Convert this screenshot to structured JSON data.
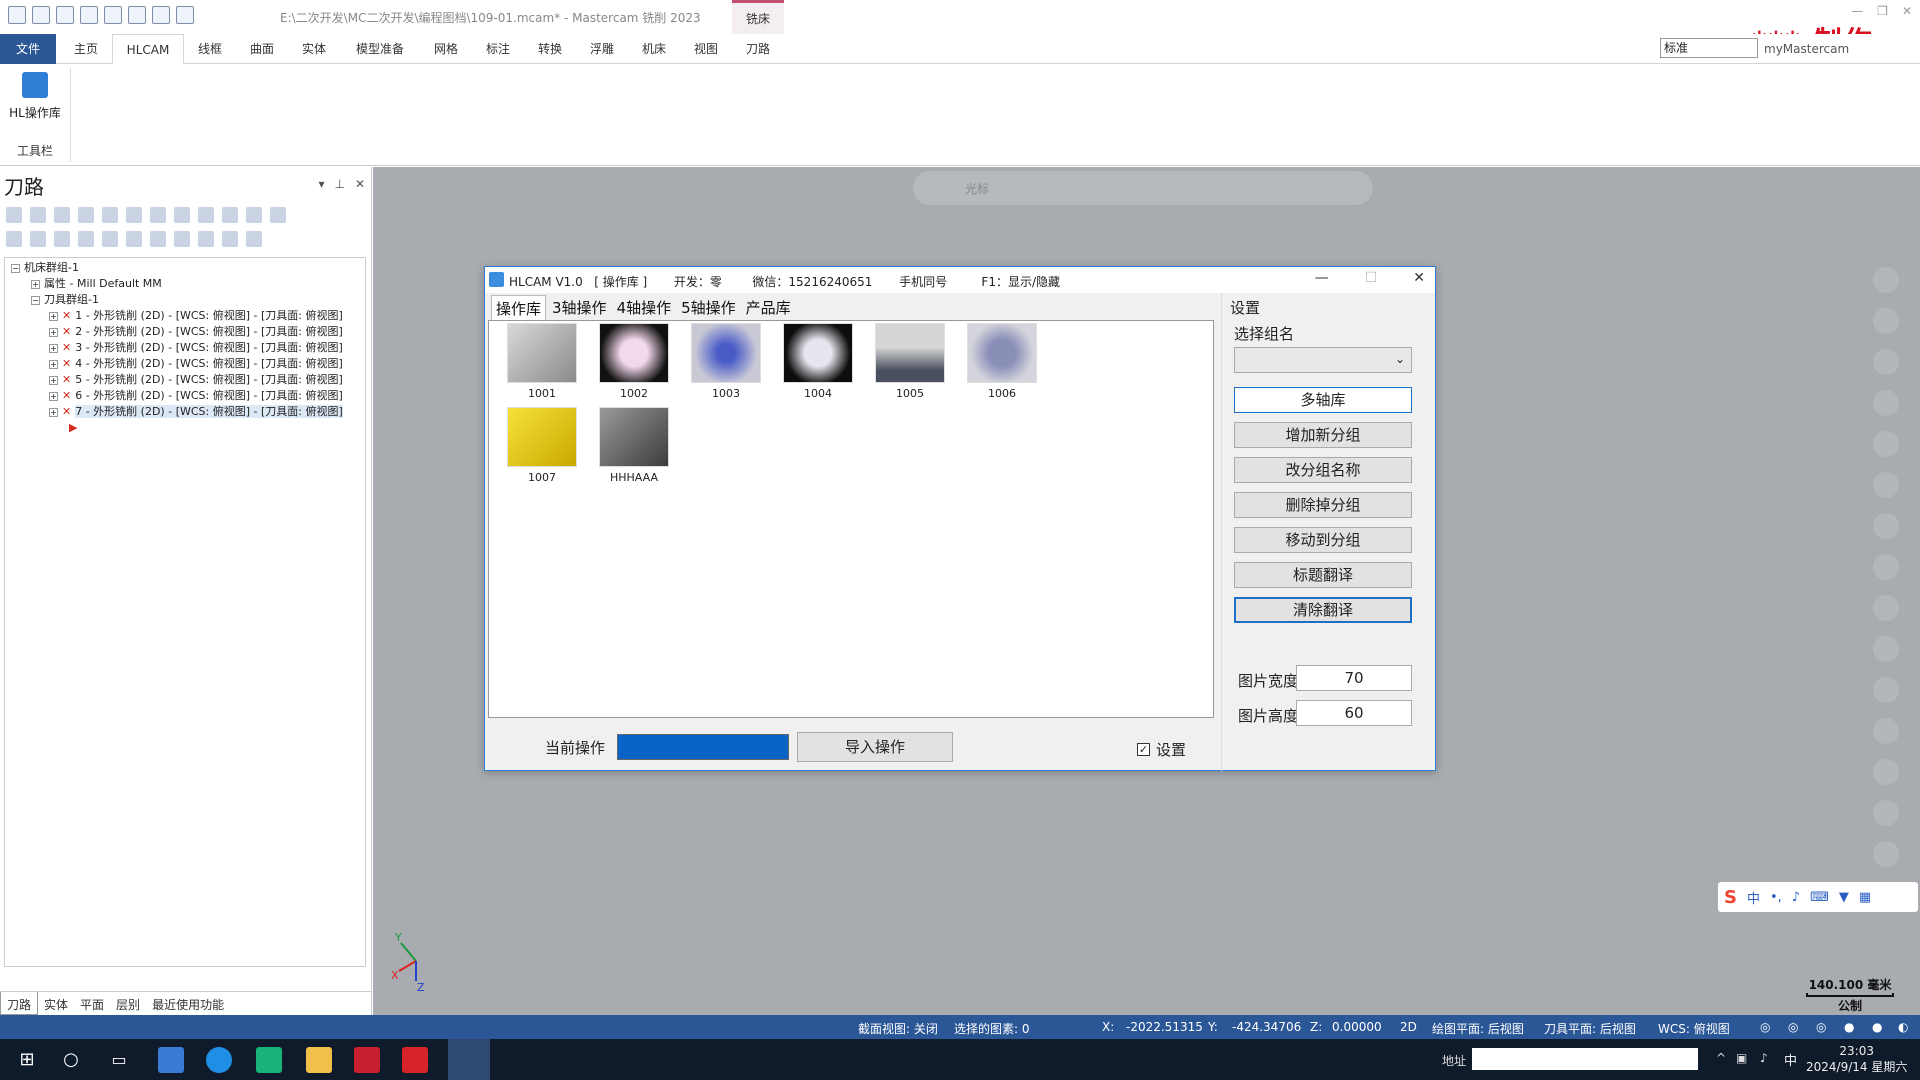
{
  "window": {
    "title": "E:\\二次开发\\MC二次开发\\编程图档\\109-01.mcam* - Mastercam 铣削 2023",
    "context_tab": "铣床",
    "watermark": "*** 制作"
  },
  "ribbon": {
    "tabs": [
      "文件",
      "主页",
      "HLCAM",
      "线框",
      "曲面",
      "实体",
      "模型准备",
      "网格",
      "标注",
      "转换",
      "浮雕",
      "机床",
      "视图",
      "刀路"
    ],
    "active_tab": "HLCAM",
    "standard_select": "标准",
    "mymastercam": "myMastercam",
    "hl_button": "HL操作库",
    "group_label": "工具栏"
  },
  "left_panel": {
    "title": "刀路",
    "tree": {
      "machine_group": "机床群组-1",
      "properties": "属性 - Mill Default MM",
      "toolpath_group": "刀具群组-1",
      "operations": [
        "1 - 外形铣削 (2D) - [WCS: 俯视图] - [刀具面: 俯视图]",
        "2 - 外形铣削 (2D) - [WCS: 俯视图] - [刀具面: 俯视图]",
        "3 - 外形铣削 (2D) - [WCS: 俯视图] - [刀具面: 俯视图]",
        "4 - 外形铣削 (2D) - [WCS: 俯视图] - [刀具面: 俯视图]",
        "5 - 外形铣削 (2D) - [WCS: 俯视图] - [刀具面: 俯视图]",
        "6 - 外形铣削 (2D) - [WCS: 俯视图] - [刀具面: 俯视图]",
        "7 - 外形铣削 (2D) - [WCS: 俯视图] - [刀具面: 俯视图]"
      ]
    },
    "bottom_tabs": [
      "刀路",
      "实体",
      "平面",
      "层别",
      "最近使用功能"
    ]
  },
  "viewport": {
    "toolbar_label": "光标",
    "scale_value": "140.100 毫米",
    "scale_unit": "公制",
    "ime_lang": "中"
  },
  "dialog": {
    "title": "HLCAM V1.0   [ 操作库 ]       开发：零        微信：15216240651       手机同号         F1：显示/隐藏",
    "tabs": [
      "操作库",
      "3轴操作",
      "4轴操作",
      "5轴操作",
      "产品库"
    ],
    "active_tab": "操作库",
    "items": [
      "1001",
      "1002",
      "1003",
      "1004",
      "1005",
      "1006",
      "1007",
      "HHHAAA"
    ],
    "current_op_label": "当前操作",
    "import_button": "导入操作",
    "settings_checkbox": "设置",
    "settings_checked": true,
    "settings": {
      "title": "设置",
      "group_label": "选择组名",
      "group_value": "",
      "name_field": "多轴库",
      "buttons": [
        "增加新分组",
        "改分组名称",
        "删除掉分组",
        "移动到分组",
        "标题翻译",
        "清除翻译"
      ],
      "width_label": "图片宽度",
      "width_value": "70",
      "height_label": "图片高度",
      "height_value": "60"
    }
  },
  "statusbar": {
    "section_view": "截面视图: 关闭",
    "selected": "选择的图素: 0",
    "x_label": "X:",
    "x_value": "-2022.51315",
    "y_label": "Y:",
    "y_value": "-424.34706",
    "z_label": "Z:",
    "z_value": "0.00000",
    "mode": "2D",
    "cplane": "绘图平面: 后视图",
    "tplane": "刀具平面: 后视图",
    "wcs": "WCS: 俯视图"
  },
  "taskbar": {
    "address_label": "地址",
    "ime": "中",
    "time": "23:03",
    "date": "2024/9/14 星期六"
  },
  "colors": {
    "accent": "#2b5797",
    "dialog_border": "#2d7fd1",
    "progress": "#0a63c7",
    "viewport_bg": "#a8abb0"
  }
}
